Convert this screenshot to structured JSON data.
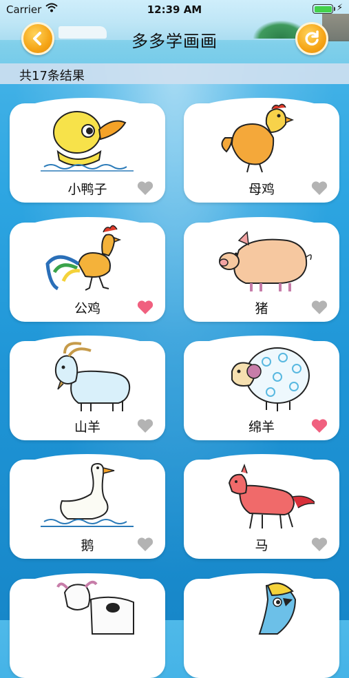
{
  "status_bar": {
    "carrier": "Carrier",
    "time": "12:39 AM",
    "battery_level": 1.0
  },
  "header": {
    "title": "多多学画画",
    "back_icon": "chevron-left-icon",
    "refresh_icon": "refresh-icon"
  },
  "results": {
    "count_text": "共17条结果"
  },
  "colors": {
    "accent_orange": "#f5a416",
    "heart_liked": "#f0607f",
    "heart_unliked": "#b3b3b3",
    "background": "#2ea6e2"
  },
  "items": [
    {
      "name": "小鸭子",
      "liked": false,
      "icon": "duckling-drawing"
    },
    {
      "name": "母鸡",
      "liked": false,
      "icon": "hen-drawing"
    },
    {
      "name": "公鸡",
      "liked": true,
      "icon": "rooster-drawing"
    },
    {
      "name": "猪",
      "liked": false,
      "icon": "pig-drawing"
    },
    {
      "name": "山羊",
      "liked": false,
      "icon": "goat-drawing"
    },
    {
      "name": "绵羊",
      "liked": true,
      "icon": "sheep-drawing"
    },
    {
      "name": "鹅",
      "liked": false,
      "icon": "goose-drawing"
    },
    {
      "name": "马",
      "liked": false,
      "icon": "horse-drawing"
    },
    {
      "name": "",
      "liked": false,
      "icon": "cow-drawing"
    },
    {
      "name": "",
      "liked": false,
      "icon": "parrot-drawing"
    }
  ]
}
